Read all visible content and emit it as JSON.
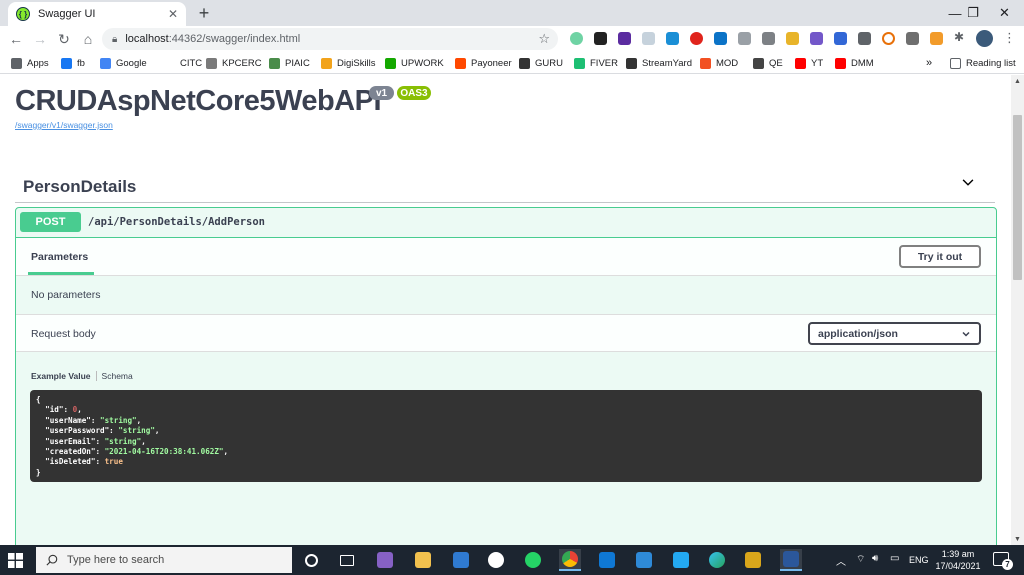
{
  "browser": {
    "tab_title": "Swagger UI",
    "url_host": "localhost",
    "url_rest": ":44362/swagger/index.html",
    "bookmarks": [
      {
        "label": "Apps",
        "color": "#5f6368"
      },
      {
        "label": "fb",
        "color": "#1877f2"
      },
      {
        "label": "Google",
        "color": "#4285f4"
      },
      {
        "label": "CITC",
        "color": "#ffffff"
      },
      {
        "label": "KPCERC",
        "color": "#7a7a7a"
      },
      {
        "label": "PIAIC",
        "color": "#4a8c4a"
      },
      {
        "label": "DigiSkills",
        "color": "#f2a31b"
      },
      {
        "label": "UPWORK",
        "color": "#14a800"
      },
      {
        "label": "Payoneer",
        "color": "#ff4800"
      },
      {
        "label": "GURU",
        "color": "#333333"
      },
      {
        "label": "FIVER",
        "color": "#1dbf73"
      },
      {
        "label": "StreamYard",
        "color": "#333333"
      },
      {
        "label": "MOD",
        "color": "#f25022"
      },
      {
        "label": "QE",
        "color": "#444444"
      },
      {
        "label": "YT",
        "color": "#ff0000"
      },
      {
        "label": "DMM",
        "color": "#ff0000"
      }
    ],
    "more_bookmarks": "»",
    "reading_list": "Reading list"
  },
  "page": {
    "title": "CRUDAspNetCore5WebAPI",
    "version_badge": "v1",
    "oas_badge": "OAS3",
    "spec_link": "/swagger/v1/swagger.json",
    "tag": "PersonDetails",
    "operation": {
      "method": "POST",
      "path": "/api/PersonDetails/AddPerson",
      "parameters_tab": "Parameters",
      "try_it_out": "Try it out",
      "no_parameters": "No parameters",
      "request_body": "Request body",
      "content_type": "application/json",
      "example_value_tab": "Example Value",
      "schema_tab": "Schema",
      "example": {
        "open": "{",
        "close": "}",
        "fields": [
          {
            "key": "\"id\"",
            "value": "0",
            "type": "n",
            "comma": ","
          },
          {
            "key": "\"userName\"",
            "value": "\"string\"",
            "type": "s",
            "comma": ","
          },
          {
            "key": "\"userPassword\"",
            "value": "\"string\"",
            "type": "s",
            "comma": ","
          },
          {
            "key": "\"userEmail\"",
            "value": "\"string\"",
            "type": "s",
            "comma": ","
          },
          {
            "key": "\"createdOn\"",
            "value": "\"2021-04-16T20:38:41.062Z\"",
            "type": "s",
            "comma": ","
          },
          {
            "key": "\"isDeleted\"",
            "value": "true",
            "type": "b",
            "comma": ""
          }
        ]
      }
    }
  },
  "taskbar": {
    "search_placeholder": "Type here to search",
    "language": "ENG",
    "time": "1:39 am",
    "date": "17/04/2021",
    "notification_count": "7"
  },
  "colors": {
    "post_green": "#49cc90",
    "swagger_text": "#3b4151",
    "code_bg": "#333333"
  }
}
